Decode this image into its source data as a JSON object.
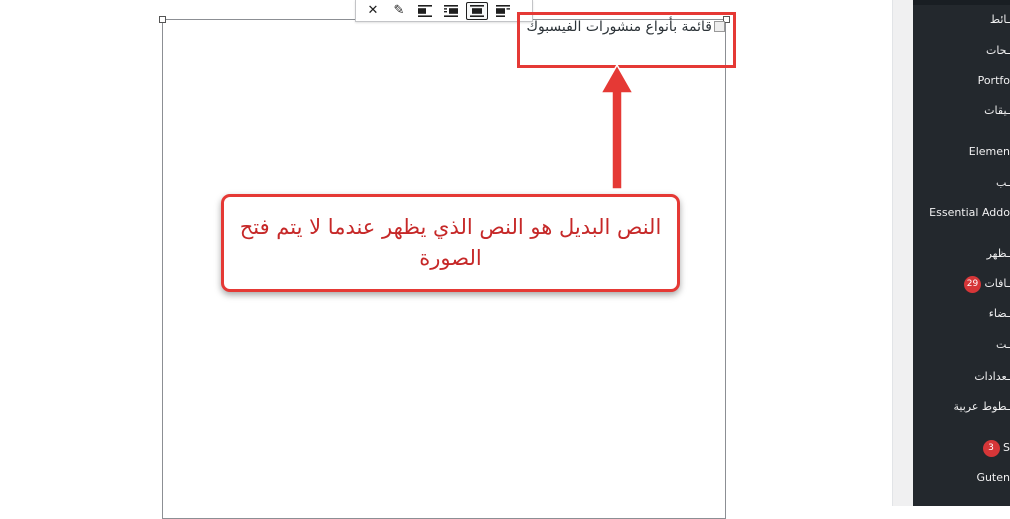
{
  "toolbar": {
    "remove_glyph": "✕",
    "edit_glyph": "✎",
    "buttons": [
      "remove",
      "edit",
      "align-left",
      "align-right",
      "align-center",
      "align-none"
    ],
    "active": "align-center"
  },
  "image_block": {
    "alt_text": "قائمة بأنواع منشورات الفيسبوك"
  },
  "annotation": {
    "callout_text": "النص البديل هو النص الذي يظهر عندما لا يتم فتح الصورة",
    "color": "#e53935"
  },
  "sidebar": {
    "items": [
      {
        "label": "ـائط"
      },
      {
        "label": "ـحات"
      },
      {
        "label": "Portfo"
      },
      {
        "label": "ـيقات"
      },
      {
        "label": "Elemen"
      },
      {
        "label": "ـب"
      },
      {
        "label": "Essential Addo"
      },
      {
        "label": "ـظهر"
      },
      {
        "label": "ـافات",
        "badge": "29"
      },
      {
        "label": "ـضاء"
      },
      {
        "label": "ـت"
      },
      {
        "label": "ـعدادات"
      },
      {
        "label": "ـطوط عربية"
      },
      {
        "label": "S",
        "badge": "3"
      },
      {
        "label": "Guten"
      }
    ]
  }
}
